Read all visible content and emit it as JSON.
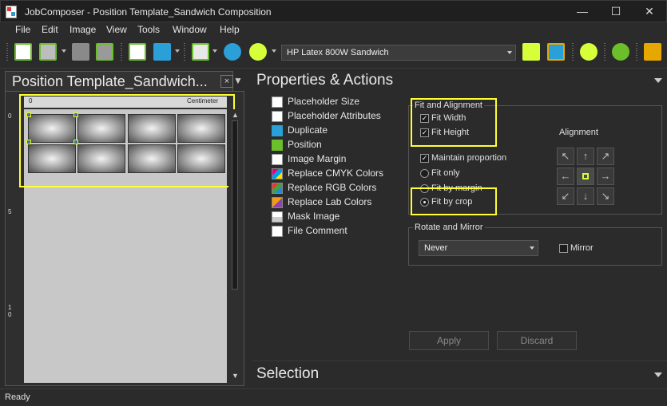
{
  "window": {
    "title": "JobComposer - Position Template_Sandwich Composition",
    "minimize": "—",
    "maximize": "☐",
    "close": "✕"
  },
  "menu": [
    "File",
    "Edit",
    "Image",
    "View",
    "Tools",
    "Window",
    "Help"
  ],
  "toolbar": {
    "device": "HP Latex 800W Sandwich",
    "icons": [
      "add-icon",
      "add-template-icon",
      "printer-icon",
      "edit-icon",
      "export-icon",
      "print-icon",
      "grid-icon",
      "settings-icon",
      "zoom-icon",
      "fit-icon",
      "gear-icon",
      "zoom-fit-icon",
      "zoom-in-icon",
      "layout-icon"
    ]
  },
  "left_panel": {
    "title": "Position Template_Sandwich...",
    "close": "×",
    "menu_arrow": "▼",
    "ruler_unit": "Centimeter",
    "ruler_h_zero": "0",
    "ruler_v": [
      "0",
      "5",
      "1 0"
    ]
  },
  "properties": {
    "title": "Properties & Actions",
    "actions": [
      {
        "label": "Placeholder Size",
        "icon": "placeholder-size-icon"
      },
      {
        "label": "Placeholder Attributes",
        "icon": "placeholder-attributes-icon"
      },
      {
        "label": "Duplicate",
        "icon": "duplicate-icon"
      },
      {
        "label": "Position",
        "icon": "position-icon"
      },
      {
        "label": "Image Margin",
        "icon": "image-margin-icon"
      },
      {
        "label": "Replace CMYK Colors",
        "icon": "replace-cmyk-icon"
      },
      {
        "label": "Replace RGB Colors",
        "icon": "replace-rgb-icon"
      },
      {
        "label": "Replace Lab Colors",
        "icon": "replace-lab-icon"
      },
      {
        "label": "Mask Image",
        "icon": "mask-image-icon"
      },
      {
        "label": "File Comment",
        "icon": "file-comment-icon"
      }
    ],
    "fit": {
      "group_title": "Fit and Alignment",
      "fit_width": "Fit Width",
      "fit_height": "Fit Height",
      "maintain": "Maintain proportion",
      "fit_only": "Fit only",
      "fit_by_margin": "Fit by margin",
      "fit_by_crop": "Fit by crop",
      "alignment_label": "Alignment",
      "checks": {
        "fit_width": true,
        "fit_height": true,
        "maintain": true
      },
      "selected_radio": "fit_by_crop"
    },
    "rotate": {
      "group_title": "Rotate and Mirror",
      "value": "Never",
      "mirror": "Mirror"
    },
    "apply": "Apply",
    "discard": "Discard"
  },
  "selection": {
    "title": "Selection"
  },
  "status": {
    "text": "Ready"
  },
  "colors": {
    "highlight": "#ffff33",
    "accent": "#d6ff3a"
  }
}
